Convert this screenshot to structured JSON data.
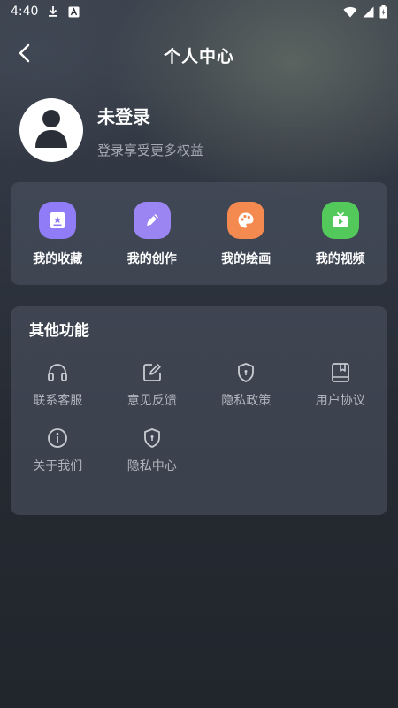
{
  "status_bar": {
    "time": "4:40",
    "icons": [
      "download-icon",
      "a-box-icon",
      "wifi-icon",
      "signal-icon",
      "battery-icon"
    ]
  },
  "header": {
    "title": "个人中心",
    "back_icon": "chevron-left-icon"
  },
  "profile": {
    "name": "未登录",
    "subtitle": "登录享受更多权益",
    "avatar_icon": "user-silhouette-icon"
  },
  "quick_actions": [
    {
      "label": "我的收藏",
      "icon": "favorites-icon",
      "color": "#8f7cf6"
    },
    {
      "label": "我的创作",
      "icon": "pencil-icon",
      "color": "#9a85f3"
    },
    {
      "label": "我的绘画",
      "icon": "palette-icon",
      "color": "#f58a50"
    },
    {
      "label": "我的视频",
      "icon": "tv-play-icon",
      "color": "#52c95a"
    }
  ],
  "functions": {
    "title": "其他功能",
    "items": [
      {
        "label": "联系客服",
        "icon": "headphones-icon"
      },
      {
        "label": "意见反馈",
        "icon": "edit-feedback-icon"
      },
      {
        "label": "隐私政策",
        "icon": "shield-icon"
      },
      {
        "label": "用户协议",
        "icon": "agreement-book-icon"
      },
      {
        "label": "关于我们",
        "icon": "info-icon"
      },
      {
        "label": "隐私中心",
        "icon": "shield-icon"
      }
    ]
  }
}
